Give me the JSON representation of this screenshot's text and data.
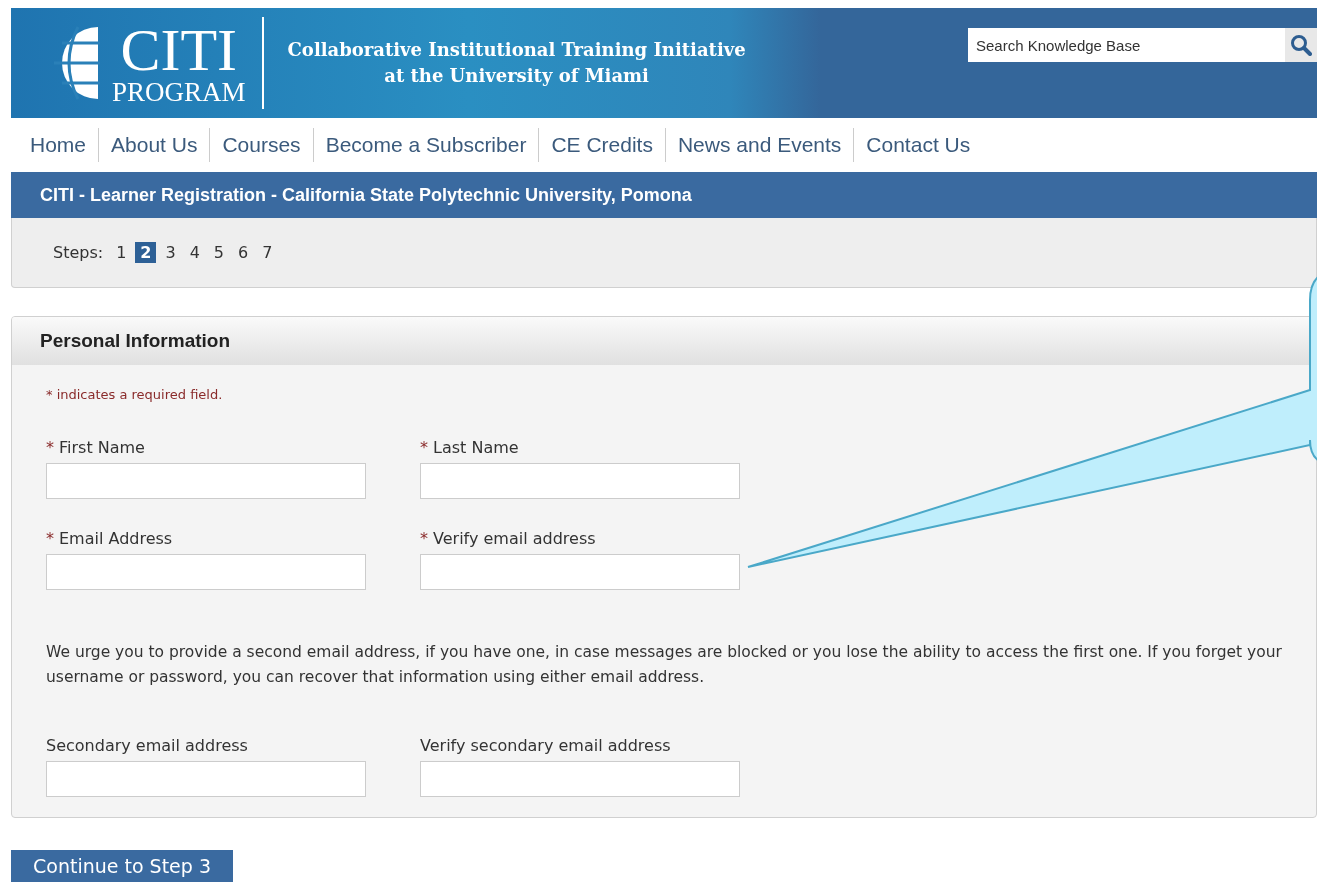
{
  "header": {
    "logo_top": "CITI",
    "logo_bottom": "PROGRAM",
    "tagline_1": "Collaborative Institutional Training Initiative",
    "tagline_2": "at the University of Miami",
    "search": {
      "placeholder": "Search Knowledge Base"
    }
  },
  "nav": [
    "Home",
    "About Us",
    "Courses",
    "Become a Subscriber",
    "CE Credits",
    "News and Events",
    "Contact Us"
  ],
  "title_bar": "CITI - Learner Registration - California State Polytechnic University, Pomona",
  "steps": {
    "label": "Steps:",
    "items": [
      {
        "label": "1",
        "selected": false
      },
      {
        "label": "2",
        "selected": true
      },
      {
        "label": "3",
        "selected": false
      },
      {
        "label": "4",
        "selected": false
      },
      {
        "label": "5",
        "selected": false
      },
      {
        "label": "6",
        "selected": false
      },
      {
        "label": "7",
        "selected": false
      }
    ]
  },
  "panel": {
    "title": "Personal Information",
    "note": "* indicates a required field.",
    "rows": [
      {
        "fields": [
          {
            "label": "First Name",
            "required": true,
            "mark": "*"
          },
          {
            "label": "Last Name",
            "required": true,
            "mark": "*"
          }
        ]
      },
      {
        "fields": [
          {
            "label": "Email Address",
            "required": true,
            "mark": "*"
          },
          {
            "label": "Verify email address",
            "required": true,
            "mark": "*"
          }
        ]
      },
      {
        "paragraph": "We urge you to provide a second email address, if you have one, in case messages are blocked or you lose the ability to access the first one. If you forget your username or password, you can recover that information using either email address."
      },
      {
        "fields": [
          {
            "label": "Secondary email address",
            "required": false
          },
          {
            "label": "Verify secondary email address",
            "required": false
          }
        ]
      }
    ]
  },
  "continue_button": "Continue to Step 3"
}
